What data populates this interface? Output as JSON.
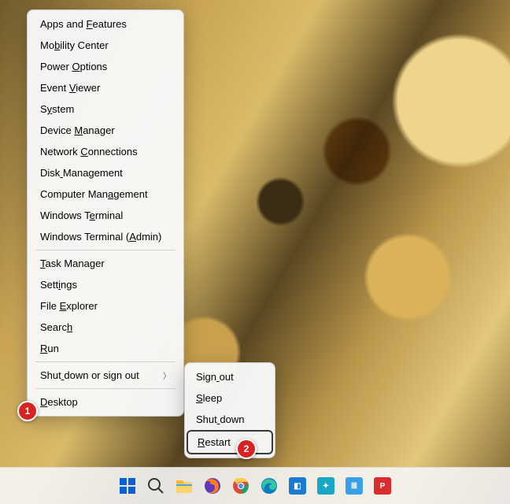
{
  "menu": {
    "items": [
      {
        "label": "Apps and Features",
        "u": 9
      },
      {
        "label": "Mobility Center",
        "u": 2
      },
      {
        "label": "Power Options",
        "u": 6
      },
      {
        "label": "Event Viewer",
        "u": 6
      },
      {
        "label": "System",
        "u": 1
      },
      {
        "label": "Device Manager",
        "u": 7
      },
      {
        "label": "Network Connections",
        "u": 8
      },
      {
        "label": "Disk Management",
        "u": 4
      },
      {
        "label": "Computer Management",
        "u": 12
      },
      {
        "label": "Windows Terminal",
        "u": 9
      },
      {
        "label": "Windows Terminal (Admin)",
        "u": 18
      }
    ],
    "items2": [
      {
        "label": "Task Manager",
        "u": 0
      },
      {
        "label": "Settings",
        "u": 4
      },
      {
        "label": "File Explorer",
        "u": 5
      },
      {
        "label": "Search",
        "u": 5
      },
      {
        "label": "Run",
        "u": 0
      }
    ],
    "shutdown_label": "Shut down or sign out",
    "shutdown_u": 4,
    "desktop_label": "Desktop",
    "desktop_u": 0
  },
  "submenu": {
    "items": [
      {
        "label": "Sign out",
        "u": 4
      },
      {
        "label": "Sleep",
        "u": 0
      },
      {
        "label": "Shut down",
        "u": 4
      },
      {
        "label": "Restart",
        "u": 0
      }
    ]
  },
  "annotations": {
    "badge1": "1",
    "badge2": "2"
  },
  "taskbar": {
    "icons": [
      {
        "name": "start",
        "aria": "Start"
      },
      {
        "name": "search",
        "aria": "Search"
      },
      {
        "name": "explorer",
        "aria": "File Explorer"
      },
      {
        "name": "firefox",
        "aria": "Firefox"
      },
      {
        "name": "chrome",
        "aria": "Chrome"
      },
      {
        "name": "edge",
        "aria": "Edge"
      },
      {
        "name": "app-blue",
        "aria": "App"
      },
      {
        "name": "app-teal",
        "aria": "App"
      },
      {
        "name": "notes",
        "aria": "Notepad"
      },
      {
        "name": "app-red",
        "aria": "App"
      }
    ]
  }
}
